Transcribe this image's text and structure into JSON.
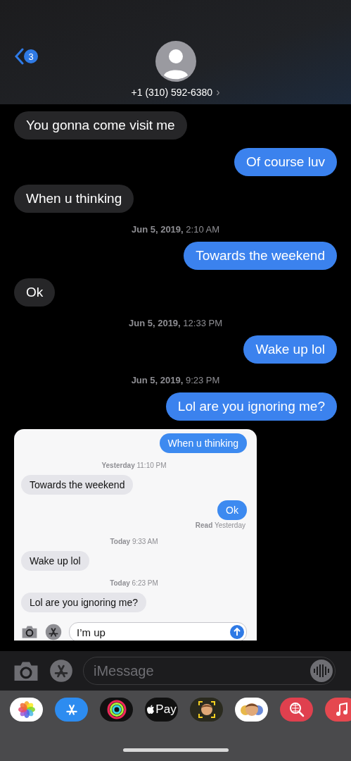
{
  "header": {
    "back_badge": "3",
    "contact": "+1 (310) 592-6380",
    "chevron": "›"
  },
  "messages": [
    {
      "kind": "incoming",
      "text": "You gonna come visit me"
    },
    {
      "kind": "outgoing",
      "text": "Of course luv"
    },
    {
      "kind": "incoming",
      "text": "When u thinking"
    },
    {
      "kind": "timestamp",
      "text": "**Jun 5, 2019,** 2:10 AM"
    },
    {
      "kind": "outgoing",
      "text": "Towards the weekend"
    },
    {
      "kind": "incoming",
      "text": "Ok"
    },
    {
      "kind": "timestamp",
      "text": "**Jun 5, 2019,** 12:33 PM"
    },
    {
      "kind": "outgoing",
      "text": "Wake up lol"
    },
    {
      "kind": "timestamp",
      "text": "**Jun 5, 2019,** 9:23 PM"
    },
    {
      "kind": "outgoing",
      "text": "Lol are you ignoring me?"
    }
  ],
  "screenshot": {
    "messages": [
      {
        "kind": "outgoing",
        "text": "When u thinking"
      },
      {
        "kind": "timestamp",
        "text": "**Yesterday** 11:10 PM"
      },
      {
        "kind": "incoming",
        "text": "Towards the weekend"
      },
      {
        "kind": "outgoing",
        "text": "Ok"
      },
      {
        "kind": "receipt",
        "text": "**Read** Yesterday"
      },
      {
        "kind": "timestamp",
        "text": "**Today** 9:33 AM"
      },
      {
        "kind": "incoming",
        "text": "Wake up lol"
      },
      {
        "kind": "timestamp",
        "text": "**Today** 6:23 PM"
      },
      {
        "kind": "incoming",
        "text": "Lol are you ignoring me?"
      }
    ],
    "composer_value": "I’m up"
  },
  "composer": {
    "placeholder": "iMessage"
  },
  "apps": [
    {
      "kind": "photos"
    },
    {
      "kind": "appstore"
    },
    {
      "kind": "activity"
    },
    {
      "kind": "pay",
      "label": "Pay"
    },
    {
      "kind": "memoji"
    },
    {
      "kind": "stickers"
    },
    {
      "kind": "search"
    },
    {
      "kind": "music"
    }
  ]
}
